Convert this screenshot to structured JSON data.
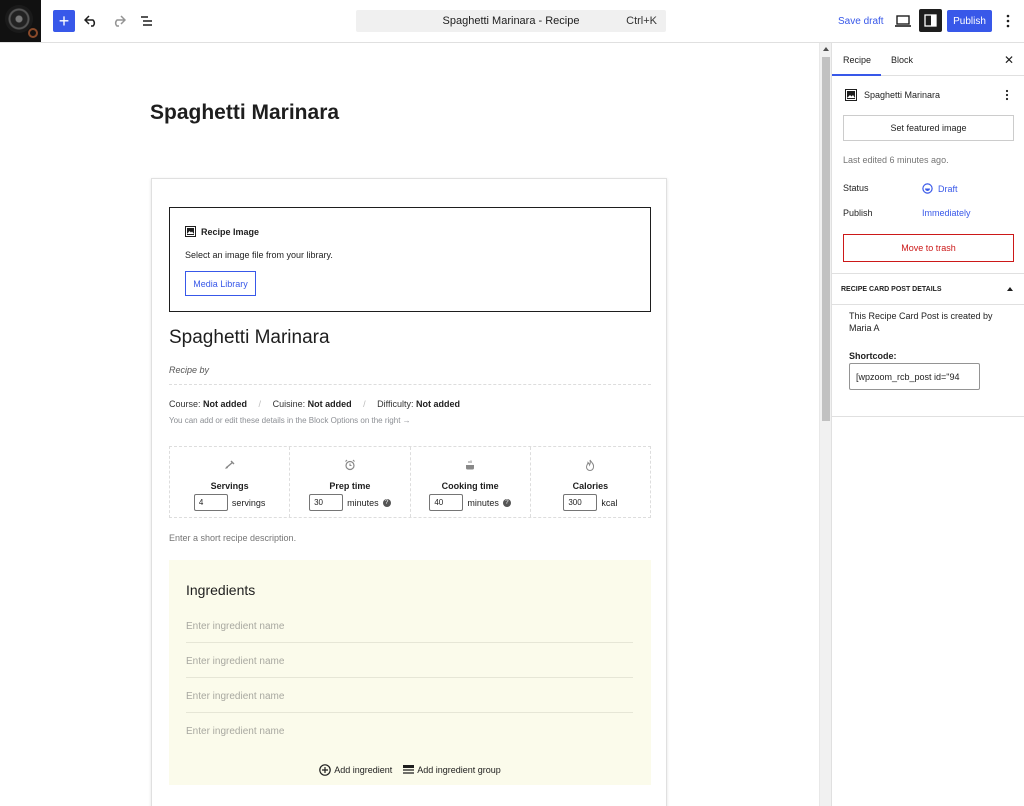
{
  "topbar": {
    "command_title": "Spaghetti Marinara - Recipe",
    "command_shortcut": "Ctrl+K",
    "add_label": "+",
    "save_draft": "Save draft",
    "publish": "Publish"
  },
  "editor": {
    "post_title": "Spaghetti Marinara",
    "image_block": {
      "label": "Recipe Image",
      "instructions": "Select an image file from your library.",
      "media_button": "Media Library"
    },
    "recipe_title": "Spaghetti Marinara",
    "recipe_by": "Recipe by",
    "meta": {
      "course_label": "Course:",
      "course_value": "Not added",
      "cuisine_label": "Cuisine:",
      "cuisine_value": "Not added",
      "difficulty_label": "Difficulty:",
      "difficulty_value": "Not added",
      "separator": "/",
      "hint": "You can add or edit these details in the Block Options on the right →"
    },
    "details": [
      {
        "label": "Servings",
        "value": "4",
        "unit": "servings",
        "icon": "servings-icon"
      },
      {
        "label": "Prep time",
        "value": "30",
        "unit": "minutes",
        "icon": "alarm-clock-icon"
      },
      {
        "label": "Cooking time",
        "value": "40",
        "unit": "minutes",
        "icon": "cooking-pot-icon"
      },
      {
        "label": "Calories",
        "value": "300",
        "unit": "kcal",
        "icon": "flame-icon"
      }
    ],
    "help_glyph": "?",
    "description_placeholder": "Enter a short recipe description.",
    "ingredients": {
      "heading": "Ingredients",
      "items": [
        "Enter ingredient name",
        "Enter ingredient name",
        "Enter ingredient name",
        "Enter ingredient name"
      ],
      "add_ingredient": "Add ingredient",
      "add_group": "Add ingredient group"
    }
  },
  "sidebar": {
    "tabs": [
      "Recipe",
      "Block"
    ],
    "close": "✕",
    "doc_title": "Spaghetti Marinara",
    "featured_image_button": "Set featured image",
    "last_edited": "Last edited 6 minutes ago.",
    "status_label": "Status",
    "status_value": "Draft",
    "publish_label": "Publish",
    "publish_value": "Immediately",
    "trash_button": "Move to trash",
    "panel_title": "RECIPE CARD POST DETAILS",
    "created_by": "This Recipe Card Post is created by Maria A",
    "shortcode_label": "Shortcode:",
    "shortcode_value": "[wpzoom_rcb_post id=\"94"
  },
  "colors": {
    "accent": "#3858e9",
    "danger": "#cc1818",
    "ingredients_bg": "#fbfbeb"
  }
}
